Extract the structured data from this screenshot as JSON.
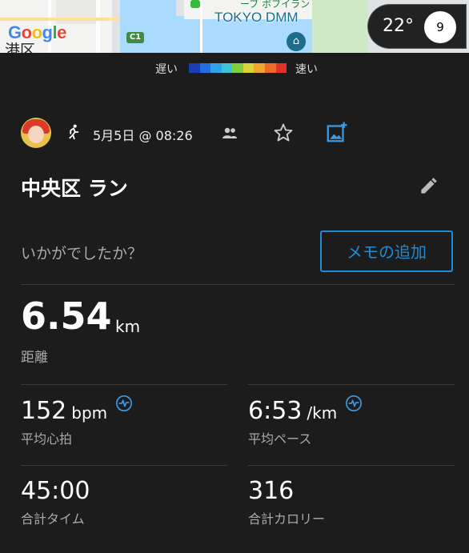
{
  "map": {
    "provider_logo": "Google",
    "ward_label": "港区",
    "road_badge": "C1",
    "place_label": "TOKYO DMM",
    "top_text": "ーブ ボブイラン"
  },
  "weather": {
    "temperature": "22°",
    "compass_value": "9"
  },
  "speed_legend": {
    "slow": "遅い",
    "fast": "速い",
    "colors": [
      "#1a3fb5",
      "#1f6fe0",
      "#2fa2e8",
      "#3cc3d8",
      "#7fcf3f",
      "#d8d43a",
      "#f0a42f",
      "#ef6a2a",
      "#e0302a"
    ]
  },
  "activity": {
    "date_time": "5月5日 @ 08:26",
    "title": "中央区 ラン",
    "feeling_prompt": "いかがでしたか？",
    "memo_button": "メモの追加"
  },
  "stats": {
    "distance": {
      "value": "6.54",
      "unit": "km",
      "label": "距離"
    },
    "heart_rate": {
      "value": "152",
      "unit": "bpm",
      "label": "平均心拍"
    },
    "pace": {
      "value": "6:53",
      "unit": "/km",
      "label": "平均ペース"
    },
    "time": {
      "value": "45:00",
      "label": "合計タイム"
    },
    "calories": {
      "value": "316",
      "label": "合計カロリー"
    }
  },
  "colors": {
    "accent": "#1f8bd6",
    "background": "#1c1c1c",
    "muted_text": "#aaaaaa"
  },
  "icons": [
    "running-icon",
    "people-icon",
    "star-icon",
    "add-photo-icon",
    "edit-pencil-icon",
    "heart-rate-icon",
    "compass-icon"
  ]
}
